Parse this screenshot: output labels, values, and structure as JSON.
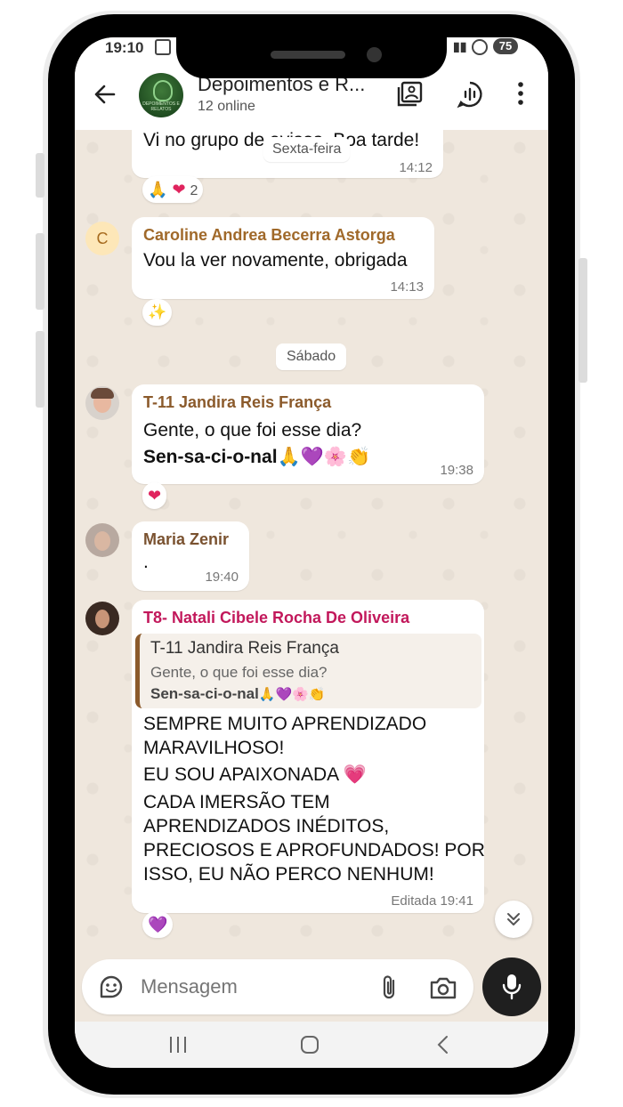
{
  "status_bar": {
    "time": "19:10",
    "battery": "75"
  },
  "header": {
    "title": "Depoimentos e R...",
    "subtitle": "12 online",
    "avatar_text": "DEPOIMENTOS E RELATOS"
  },
  "messages": [
    {
      "text": "Vi no grupo de avisos. Boa tarde!",
      "time": "14:12",
      "reaction_count": "2",
      "day_overlay": "Sexta-feira"
    },
    {
      "sender": "Caroline Andrea Becerra Astorga",
      "avatar_letter": "C",
      "text": "Vou la ver novamente,  obrigada",
      "time": "14:13"
    },
    {
      "day": "Sábado"
    },
    {
      "sender": "T-11 Jandira Reis França",
      "line1": "Gente, o que foi esse dia?",
      "line2": "Sen-sa-ci-o-nal",
      "time": "19:38"
    },
    {
      "sender": "Maria Zenir",
      "text": ".",
      "time": "19:40"
    },
    {
      "sender": "T8- Natali Cibele Rocha De Oliveira",
      "quote_sender": "T-11 Jandira Reis França",
      "quote_line1": "Gente, o que foi esse dia?",
      "quote_line2": "Sen-sa-ci-o-nal",
      "lines": [
        "SEMPRE MUITO APRENDIZADO",
        "MARAVILHOSO!",
        "EU SOU APAIXONADA",
        "CADA IMERSÃO TEM",
        "APRENDIZADOS INÉDITOS,",
        "PRECIOSOS E APROFUNDADOS! POR",
        "ISSO, EU NÃO PERCO NENHUM!"
      ],
      "edited_label": "Editada",
      "time": "19:41"
    }
  ],
  "composer": {
    "placeholder": "Mensagem"
  },
  "colors": {
    "chat_bg": "#efe7dd",
    "sender_caroline": "#a0692a",
    "sender_jandira": "#8b5a2b",
    "sender_maria": "#7a5230",
    "sender_natali": "#c2185b"
  },
  "icons": [
    "back-arrow-icon",
    "gallery-icon",
    "voice-chat-icon",
    "more-vert-icon",
    "sticker-icon",
    "attach-icon",
    "camera-icon",
    "mic-icon",
    "scroll-down-icon"
  ]
}
